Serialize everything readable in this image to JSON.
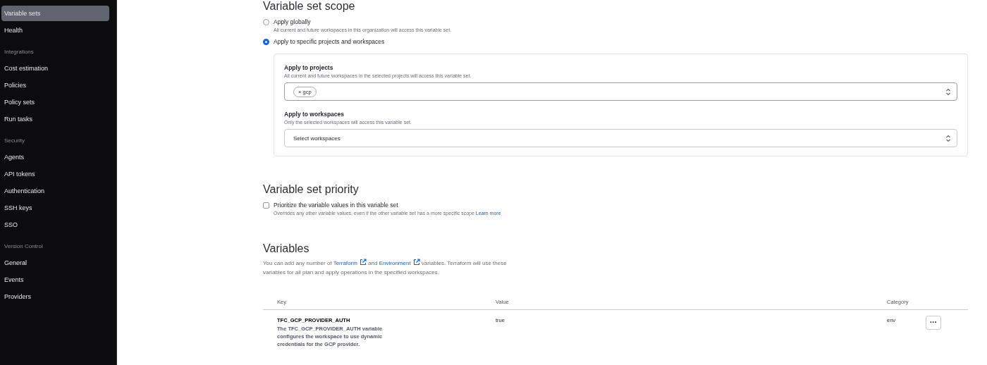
{
  "sidebar": {
    "sections": [
      {
        "items": [
          {
            "label": "Variable sets",
            "selected": true
          },
          {
            "label": "Health",
            "selected": false
          }
        ]
      },
      {
        "header": "Integrations",
        "items": [
          {
            "label": "Cost estimation",
            "selected": false
          },
          {
            "label": "Policies",
            "selected": false
          },
          {
            "label": "Policy sets",
            "selected": false
          },
          {
            "label": "Run tasks",
            "selected": false
          }
        ]
      },
      {
        "header": "Security",
        "items": [
          {
            "label": "Agents",
            "selected": false
          },
          {
            "label": "API tokens",
            "selected": false
          },
          {
            "label": "Authentication",
            "selected": false
          },
          {
            "label": "SSH keys",
            "selected": false
          },
          {
            "label": "SSO",
            "selected": false
          }
        ]
      },
      {
        "header": "Version Control",
        "items": [
          {
            "label": "General",
            "selected": false
          },
          {
            "label": "Events",
            "selected": false
          },
          {
            "label": "Providers",
            "selected": false
          }
        ]
      }
    ]
  },
  "scope": {
    "title": "Variable set scope",
    "options": [
      {
        "label": "Apply globally",
        "description": "All current and future workspaces in this organization will access this variable set.",
        "selected": false
      },
      {
        "label": "Apply to specific projects and workspaces",
        "selected": true
      }
    ],
    "projects": {
      "label": "Apply to projects",
      "description": "All current and future workspaces in the selected projects will access this variable set.",
      "tags": [
        {
          "remove": "×",
          "label": "gcp"
        }
      ]
    },
    "workspaces": {
      "label": "Apply to workspaces",
      "description": "Only the selected workspaces will access this variable set.",
      "placeholder": "Select workspaces"
    }
  },
  "priority": {
    "title": "Variable set priority",
    "label": "Prioritize the variable values in this variable set",
    "checked": false,
    "description": "Overrides any other variable values, even if the other variable set has a more specific scope",
    "link": "Learn more"
  },
  "variables": {
    "title": "Variables",
    "intro_start": "You can add any number of",
    "link_1": "Terraform",
    "intro_mid": "and",
    "link_2": "Environment",
    "intro_end": "variables. Terraform will use these variables for all plan and apply operations in the specified workspaces.",
    "table": {
      "columns": [
        "Key",
        "Value",
        "Category"
      ],
      "rows": [
        {
          "key": "TFC_GCP_PROVIDER_AUTH",
          "description": "The TFC_GCP_PROVIDER_AUTH variable configures the workspace to use dynamic credentials for the GCP provider.",
          "value": "true",
          "category": "env",
          "menu": "···"
        }
      ]
    }
  }
}
